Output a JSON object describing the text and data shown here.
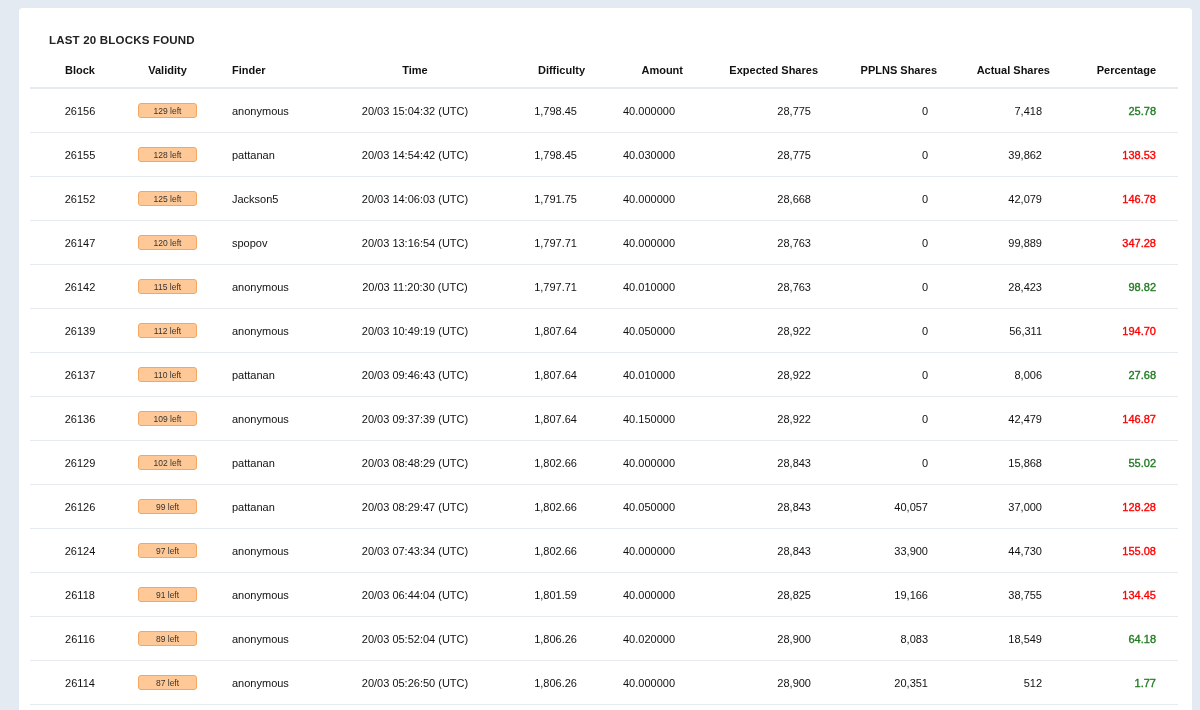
{
  "title": "LAST 20 BLOCKS FOUND",
  "columns": [
    "Block",
    "Validity",
    "Finder",
    "Time",
    "Difficulty",
    "Amount",
    "Expected Shares",
    "PPLNS Shares",
    "Actual Shares",
    "Percentage"
  ],
  "rows": [
    {
      "block": "26156",
      "validity": "129 left",
      "finder": "anonymous",
      "time": "20/03 15:04:32 (UTC)",
      "difficulty": "1,798.45",
      "amount": "40.000000",
      "expected": "28,775",
      "pplns": "0",
      "actual": "7,418",
      "percentage": "25.78",
      "color": "#217a21"
    },
    {
      "block": "26155",
      "validity": "128 left",
      "finder": "pattanan",
      "time": "20/03 14:54:42 (UTC)",
      "difficulty": "1,798.45",
      "amount": "40.030000",
      "expected": "28,775",
      "pplns": "0",
      "actual": "39,862",
      "percentage": "138.53",
      "color": "#ff0000"
    },
    {
      "block": "26152",
      "validity": "125 left",
      "finder": "Jackson5",
      "time": "20/03 14:06:03 (UTC)",
      "difficulty": "1,791.75",
      "amount": "40.000000",
      "expected": "28,668",
      "pplns": "0",
      "actual": "42,079",
      "percentage": "146.78",
      "color": "#ff0000"
    },
    {
      "block": "26147",
      "validity": "120 left",
      "finder": "spopov",
      "time": "20/03 13:16:54 (UTC)",
      "difficulty": "1,797.71",
      "amount": "40.000000",
      "expected": "28,763",
      "pplns": "0",
      "actual": "99,889",
      "percentage": "347.28",
      "color": "#ff0000"
    },
    {
      "block": "26142",
      "validity": "115 left",
      "finder": "anonymous",
      "time": "20/03 11:20:30 (UTC)",
      "difficulty": "1,797.71",
      "amount": "40.010000",
      "expected": "28,763",
      "pplns": "0",
      "actual": "28,423",
      "percentage": "98.82",
      "color": "#217a21"
    },
    {
      "block": "26139",
      "validity": "112 left",
      "finder": "anonymous",
      "time": "20/03 10:49:19 (UTC)",
      "difficulty": "1,807.64",
      "amount": "40.050000",
      "expected": "28,922",
      "pplns": "0",
      "actual": "56,311",
      "percentage": "194.70",
      "color": "#ff0000"
    },
    {
      "block": "26137",
      "validity": "110 left",
      "finder": "pattanan",
      "time": "20/03 09:46:43 (UTC)",
      "difficulty": "1,807.64",
      "amount": "40.010000",
      "expected": "28,922",
      "pplns": "0",
      "actual": "8,006",
      "percentage": "27.68",
      "color": "#217a21"
    },
    {
      "block": "26136",
      "validity": "109 left",
      "finder": "anonymous",
      "time": "20/03 09:37:39 (UTC)",
      "difficulty": "1,807.64",
      "amount": "40.150000",
      "expected": "28,922",
      "pplns": "0",
      "actual": "42,479",
      "percentage": "146.87",
      "color": "#ff0000"
    },
    {
      "block": "26129",
      "validity": "102 left",
      "finder": "pattanan",
      "time": "20/03 08:48:29 (UTC)",
      "difficulty": "1,802.66",
      "amount": "40.000000",
      "expected": "28,843",
      "pplns": "0",
      "actual": "15,868",
      "percentage": "55.02",
      "color": "#217a21"
    },
    {
      "block": "26126",
      "validity": "99 left",
      "finder": "pattanan",
      "time": "20/03 08:29:47 (UTC)",
      "difficulty": "1,802.66",
      "amount": "40.050000",
      "expected": "28,843",
      "pplns": "40,057",
      "actual": "37,000",
      "percentage": "128.28",
      "color": "#ff0000"
    },
    {
      "block": "26124",
      "validity": "97 left",
      "finder": "anonymous",
      "time": "20/03 07:43:34 (UTC)",
      "difficulty": "1,802.66",
      "amount": "40.000000",
      "expected": "28,843",
      "pplns": "33,900",
      "actual": "44,730",
      "percentage": "155.08",
      "color": "#ff0000"
    },
    {
      "block": "26118",
      "validity": "91 left",
      "finder": "anonymous",
      "time": "20/03 06:44:04 (UTC)",
      "difficulty": "1,801.59",
      "amount": "40.000000",
      "expected": "28,825",
      "pplns": "19,166",
      "actual": "38,755",
      "percentage": "134.45",
      "color": "#ff0000"
    },
    {
      "block": "26116",
      "validity": "89 left",
      "finder": "anonymous",
      "time": "20/03 05:52:04 (UTC)",
      "difficulty": "1,806.26",
      "amount": "40.020000",
      "expected": "28,900",
      "pplns": "8,083",
      "actual": "18,549",
      "percentage": "64.18",
      "color": "#217a21"
    },
    {
      "block": "26114",
      "validity": "87 left",
      "finder": "anonymous",
      "time": "20/03 05:26:50 (UTC)",
      "difficulty": "1,806.26",
      "amount": "40.000000",
      "expected": "28,900",
      "pplns": "20,351",
      "actual": "512",
      "percentage": "1.77",
      "color": "#217a21"
    }
  ]
}
